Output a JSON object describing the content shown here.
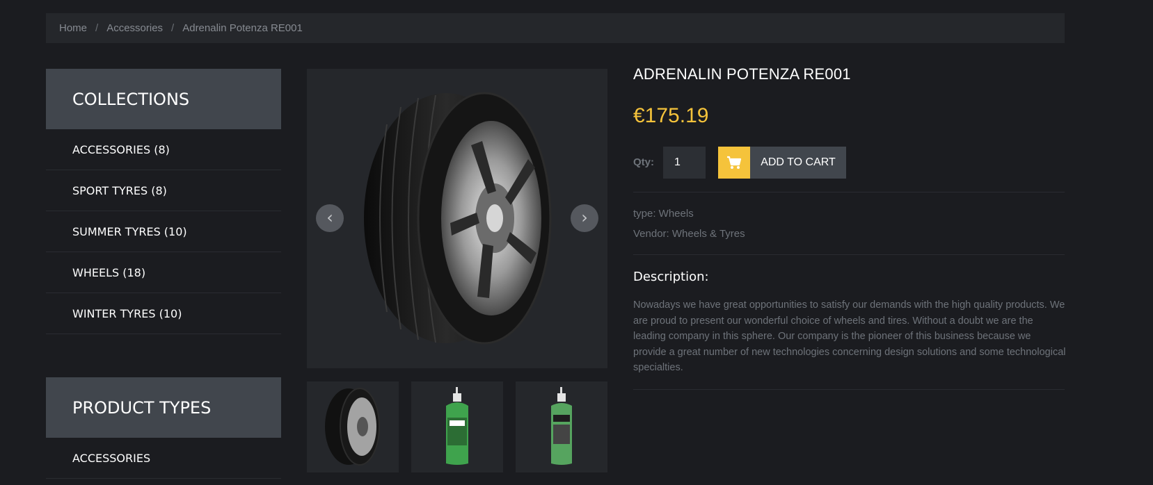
{
  "breadcrumb": {
    "home": "Home",
    "separator": "/",
    "collection": "Accessories",
    "current": "Adrenalin Potenza RE001"
  },
  "sidebar": {
    "collections_title": "COLLECTIONS",
    "collections": [
      "ACCESSORIES (8)",
      "SPORT TYRES (8)",
      "SUMMER TYRES (10)",
      "WHEELS (18)",
      "WINTER TYRES (10)"
    ],
    "types_title": "PRODUCT TYPES",
    "types": [
      "ACCESSORIES"
    ]
  },
  "gallery": {
    "main_image": "tyre-image",
    "prev_icon": "chevron-left-icon",
    "next_icon": "chevron-right-icon",
    "thumbnails": [
      "tyre-thumbnail",
      "sealant-bottle-thumbnail",
      "sealant-bottle-thumbnail"
    ]
  },
  "product": {
    "title": "ADRENALIN POTENZA RE001",
    "price": "€175.19",
    "qty_label": "Qty:",
    "qty_value": "1",
    "add_to_cart": "ADD TO CART",
    "type_line": "type: Wheels",
    "vendor_line": "Vendor: Wheels & Tyres",
    "description_title": "Description:",
    "description": "Nowadays we have great opportunities to satisfy our demands with the high quality products. We are proud to present our wonderful choice of wheels and tires. Without a doubt we are the leading company in this sphere. Our company is the pioneer of this business because we provide a great number of new technologies concerning design solutions and some technological specialties."
  },
  "colors": {
    "background": "#1b1c20",
    "panel": "#25272b",
    "header_block": "#41464d",
    "accent": "#f5c33b",
    "muted_text": "#6e737a"
  }
}
